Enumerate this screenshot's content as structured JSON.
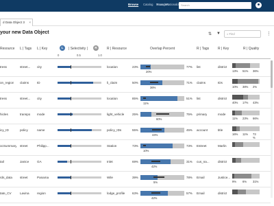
{
  "nav": {
    "items": [
      "Browse",
      "Catalog",
      "Manage",
      "Rationalization",
      "Favorites"
    ],
    "search_placeholder": "Search"
  },
  "tab": {
    "label": "d Data Object 3",
    "close": "×"
  },
  "page_title": "your new Data Object",
  "find_placeholder": "Find",
  "headers": {
    "resource": "Resource",
    "l_tags": "L | Tags",
    "l_key": "L | Key",
    "l_circle": "L",
    "selectivity": "| Selectivity |",
    "r_circle": "R",
    "r_resource": "R | Resource",
    "overlap": "Overlap Percent",
    "r_tags": "R | Tags",
    "r_key": "R | Key",
    "r_quality": "R | Quality"
  },
  "axis_ticks": [
    "0",
    "0.5",
    "1.0"
  ],
  "colors": {
    "nav": "#0f3a63",
    "bar": "#4777ad",
    "q_dark": "#555555",
    "q_mid": "#8c8c8c",
    "q_light": "#c8c8c8"
  },
  "rows": [
    {
      "resource": "tress",
      "l_tags": "street...",
      "l_key": "city",
      "selectivity": 0.32,
      "r_resource": "location",
      "left_pct": "23%",
      "overlap": 0.2,
      "center_pct": "20%",
      "right_pct": "77%",
      "r_tags": "list",
      "r_key": "district",
      "quality": [
        0.13,
        0.51,
        0.36
      ],
      "quality_labels": [
        "13%",
        "51%",
        "36%"
      ]
    },
    {
      "resource": "on_region",
      "l_tags": "claims",
      "l_key": "ID",
      "selectivity": 0.82,
      "r_resource": "li_claim",
      "left_pct": "50%",
      "overlap": 0.36,
      "center_pct": "36%",
      "right_pct": "71%",
      "r_tags": "claims",
      "r_key": "IDs",
      "quality": [
        0.1,
        0.38,
        0.02
      ],
      "quality_labels": [
        "10%",
        "38%",
        "2%"
      ]
    },
    {
      "resource": "tress",
      "l_tags": "street...",
      "l_key": "city",
      "selectivity": 0.3,
      "r_resource": "location",
      "left_pct": "85%",
      "overlap": 0.11,
      "center_pct": "11%",
      "right_pct": "51%",
      "r_tags": "list",
      "r_key": "district",
      "quality": [
        0.4,
        0.17,
        0.43
      ],
      "quality_labels": [
        "40%",
        "17%",
        "43%"
      ]
    },
    {
      "resource": "hicles",
      "l_tags": "transpo",
      "l_key": "mode",
      "selectivity": 0.35,
      "r_resource": "light_vehicle",
      "left_pct": "25%",
      "overlap": 0.6,
      "center_pct": "60%",
      "right_pct": "75%",
      "r_tags": "primary",
      "r_key": "mode",
      "quality": [
        0.11,
        0.23,
        0.66
      ],
      "quality_labels": [
        "11%",
        "23%",
        "66%"
      ]
    },
    {
      "resource": "icy_ID",
      "l_tags": "policy",
      "l_key": "name",
      "selectivity": 0.78,
      "r_resource": "policy_IDs",
      "left_pct": "55%",
      "overlap": 0.44,
      "center_pct": "44%",
      "right_pct": "45%",
      "r_tags": "account",
      "r_key": "title",
      "quality": [
        0.16,
        0.11,
        0.73
      ],
      "quality_labels": [
        "16%",
        "11%",
        "73 %"
      ]
    },
    {
      "resource": "ocSummary",
      "l_tags": "street",
      "l_key": "Philipp...",
      "selectivity": 0.3,
      "r_resource": "Station",
      "left_pct": "73%",
      "overlap": 0.1,
      "center_pct": "10%",
      "right_pct": "73%",
      "r_tags": "Estreet",
      "r_key": "Marlin",
      "quality": [
        0.1,
        0.3,
        0.6
      ],
      "quality_labels": [
        "",
        "",
        ""
      ]
    },
    {
      "resource": "tail",
      "l_tags": "Janice",
      "l_key": "GA",
      "selectivity": 0.22,
      "r_resource": "Inlet",
      "left_pct": "69%",
      "overlap": 0.42,
      "center_pct": "42%",
      "right_pct": "31%",
      "r_tags": "cus_na...",
      "r_key": "district",
      "quality": [
        0.12,
        0.2,
        0.68
      ],
      "quality_labels": [
        "",
        "",
        ""
      ]
    },
    {
      "resource": "rds_data",
      "l_tags": "street",
      "l_key": "Panama",
      "selectivity": 0.3,
      "r_resource": "Wile",
      "left_pct": "39%",
      "overlap": 0.5,
      "center_pct": "5%",
      "right_pct": "78%",
      "r_tags": "Email",
      "r_key": "Justice...",
      "quality": [
        0.09,
        0.63,
        0.31
      ],
      "quality_labels": [
        "9%",
        "6%",
        "31%"
      ]
    },
    {
      "resource": "tate_CV",
      "l_tags": "Lavina",
      "l_key": "region",
      "selectivity": 0.3,
      "r_resource": "lodge_profile",
      "left_pct": "63%",
      "overlap": 0.42,
      "center_pct": "42%",
      "right_pct": "57%",
      "r_tags": "Email",
      "r_key": "district",
      "quality": [
        0.2,
        0.3,
        0.5
      ],
      "quality_labels": [
        "",
        "",
        ""
      ]
    }
  ]
}
